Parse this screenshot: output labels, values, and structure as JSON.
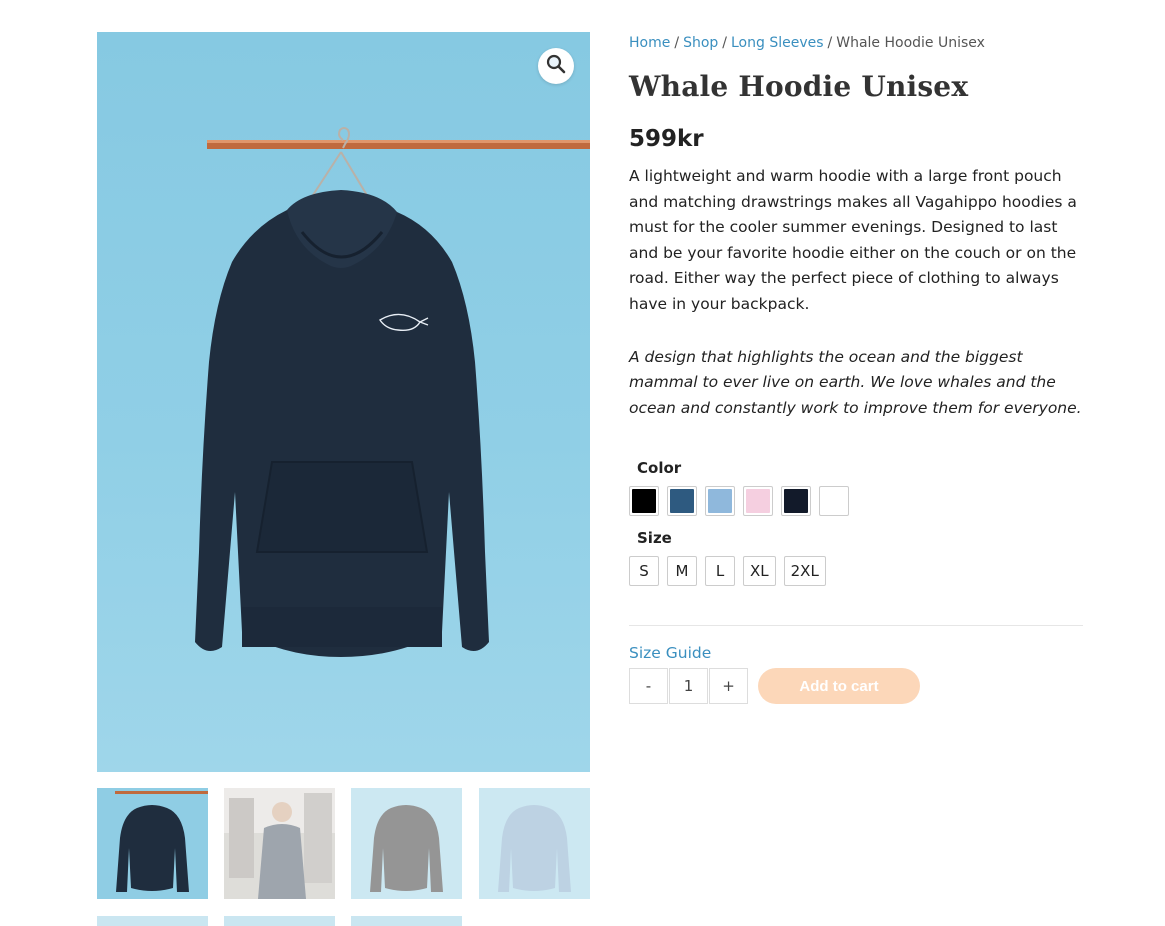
{
  "breadcrumb": {
    "items": [
      {
        "label": "Home"
      },
      {
        "label": "Shop"
      },
      {
        "label": "Long Sleeves"
      }
    ],
    "separator": "/",
    "current": "Whale Hoodie Unisex"
  },
  "product": {
    "title": "Whale Hoodie Unisex",
    "price": "599kr",
    "description": "A lightweight and warm hoodie with a large front pouch and matching drawstrings makes all Vagahippo hoodies a must for the cooler summer evenings. Designed to last and be your favorite hoodie either on the couch or on the road. Either way the perfect piece of clothing to always have in your backpack.",
    "description_italic": "A design that highlights the ocean and the biggest mammal to ever live on earth. We love whales and the ocean and constantly work to improve them for everyone."
  },
  "attributes": {
    "color_label": "Color",
    "colors": [
      "#000000",
      "#2e5a80",
      "#8fb8dc",
      "#f5cfe0",
      "#121a2a",
      "#ffffff"
    ],
    "size_label": "Size",
    "sizes": [
      "S",
      "M",
      "L",
      "XL",
      "2XL"
    ]
  },
  "cart": {
    "size_guide": "Size Guide",
    "minus": "-",
    "plus": "+",
    "quantity": "1",
    "add_to_cart": "Add to cart"
  },
  "gallery": {
    "zoom_icon": "magnifier-icon",
    "image_colors": {
      "background": "#8fcde4",
      "hoodie": "#1f2d3d",
      "rod": "#c26b3c"
    }
  }
}
